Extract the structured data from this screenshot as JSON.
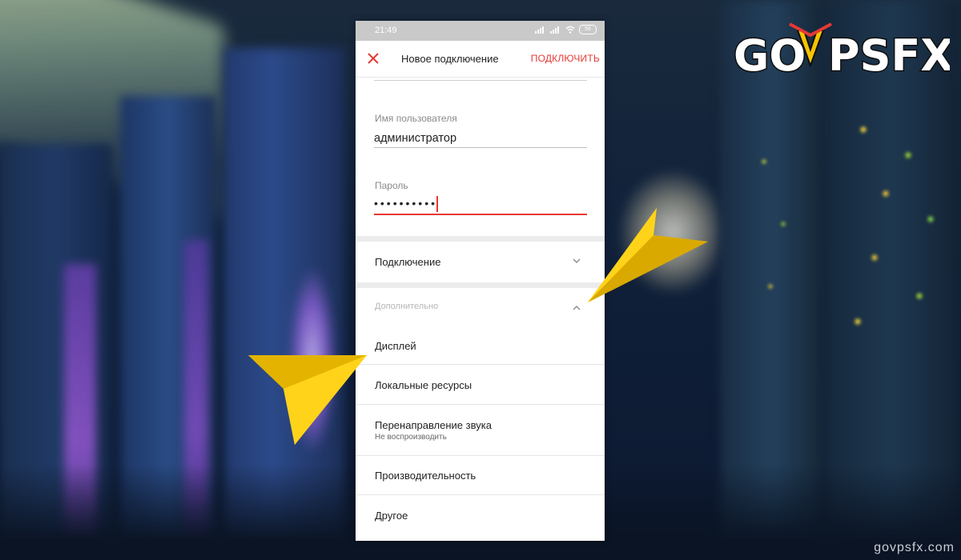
{
  "statusbar": {
    "time": "21:49",
    "battery": "56"
  },
  "appbar": {
    "title": "Новое подключение",
    "connect_label": "ПОДКЛЮЧИТЬ"
  },
  "form": {
    "username_label": "Имя пользователя",
    "username_value": "администратор",
    "password_label": "Пароль",
    "password_value": "••••••••••"
  },
  "sections": {
    "connection_label": "Подключение",
    "advanced_label": "Дополнительно"
  },
  "advanced_items": [
    {
      "label": "Дисплей"
    },
    {
      "label": "Локальные ресурсы"
    },
    {
      "label": "Перенаправление звука",
      "sublabel": "Не воспроизводить"
    },
    {
      "label": "Производительность"
    },
    {
      "label": "Другое"
    }
  ],
  "logo": {
    "text": "GOVPSFX"
  },
  "watermark": "govpsfx.com",
  "colors": {
    "accent": "#e53935",
    "arrow": "#f5c400"
  },
  "icons": {
    "close": "close-icon",
    "connection_chevron": "chevron-down-icon",
    "advanced_chevron": "chevron-up-icon"
  }
}
